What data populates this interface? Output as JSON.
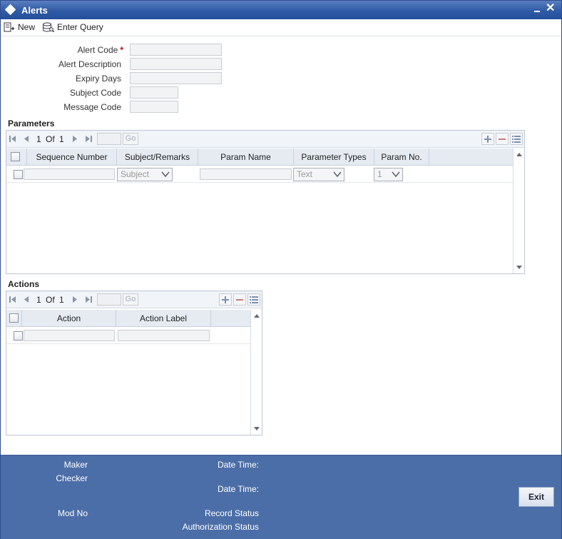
{
  "window": {
    "title": "Alerts"
  },
  "toolbar": {
    "new_label": "New",
    "enter_query_label": "Enter Query"
  },
  "form": {
    "alert_code": {
      "label": "Alert Code",
      "required_mark": "*",
      "value": ""
    },
    "alert_description": {
      "label": "Alert Description",
      "value": ""
    },
    "expiry_days": {
      "label": "Expiry Days",
      "value": ""
    },
    "subject_code": {
      "label": "Subject Code",
      "value": ""
    },
    "message_code": {
      "label": "Message Code",
      "value": ""
    }
  },
  "parameters": {
    "title": "Parameters",
    "pager": {
      "current": "1",
      "of_label": "Of",
      "total": "1",
      "go_label": "Go"
    },
    "columns": [
      "Sequence Number",
      "Subject/Remarks",
      "Param Name",
      "Parameter Types",
      "Param No."
    ],
    "rows": [
      {
        "sequence_number": "",
        "subject_remarks": "Subject",
        "param_name": "",
        "parameter_type": "Text",
        "param_no": "1"
      }
    ]
  },
  "actions": {
    "title": "Actions",
    "pager": {
      "current": "1",
      "of_label": "Of",
      "total": "1",
      "go_label": "Go"
    },
    "columns": [
      "Action",
      "Action Label"
    ],
    "rows": [
      {
        "action": "",
        "action_label": ""
      }
    ]
  },
  "footer": {
    "maker_label": "Maker",
    "checker_label": "Checker",
    "date_time_label_1": "Date Time:",
    "date_time_label_2": "Date Time:",
    "mod_no_label": "Mod No",
    "record_status_label": "Record Status",
    "authorization_status_label": "Authorization Status",
    "exit_label": "Exit"
  },
  "colors": {
    "titlebar": "#2f5aa6",
    "footer": "#4c6ea8",
    "required": "#cc0000"
  }
}
